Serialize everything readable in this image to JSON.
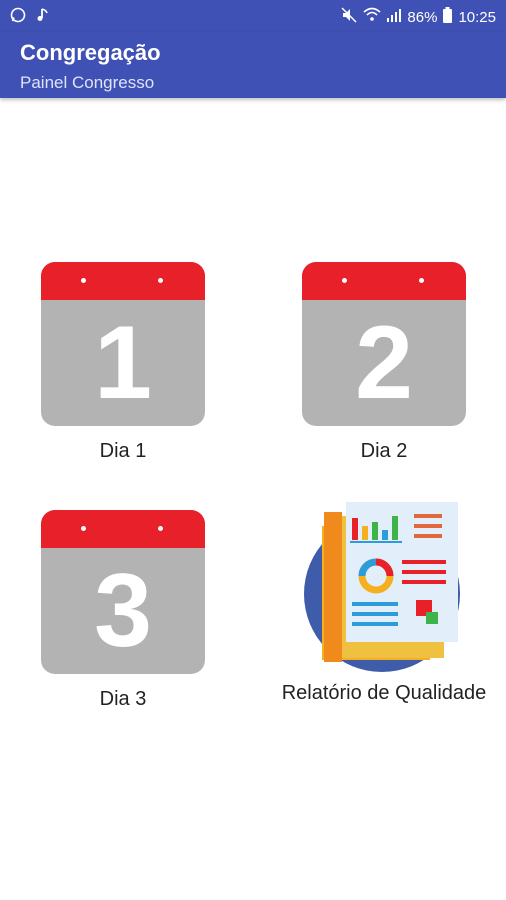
{
  "status_bar": {
    "battery": "86%",
    "time": "10:25"
  },
  "app_bar": {
    "title": "Congregação",
    "subtitle": "Painel Congresso"
  },
  "tiles": [
    {
      "label": "Dia 1",
      "number": "1",
      "icon": "calendar-day-1-icon"
    },
    {
      "label": "Dia 2",
      "number": "2",
      "icon": "calendar-day-2-icon"
    },
    {
      "label": "Dia 3",
      "number": "3",
      "icon": "calendar-day-3-icon"
    },
    {
      "label": "Relatório de Qualidade",
      "icon": "quality-report-icon"
    }
  ],
  "colors": {
    "primary": "#3f51b5",
    "calendar_header": "#e8202a",
    "calendar_body": "#b3b3b3",
    "report_circle": "#3f5cab"
  }
}
